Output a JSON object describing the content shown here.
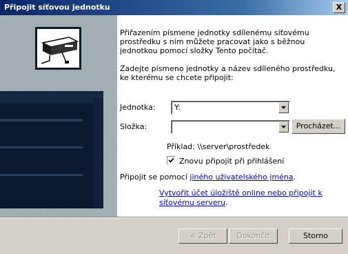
{
  "window": {
    "title": "Připojit síťovou jednotku",
    "close_label": "X"
  },
  "intro_text": "Přiřazením písmene jednotky sdílenému síťovému\nprostředku s ním můžete pracovat jako s běžnou\njednotkou pomocí složky Tento počítač.",
  "instruction_text": "Zadejte písmeno jednotky a název sdíleného prostředku,\nke kterému se chcete připojit:",
  "form": {
    "drive_label": "Jednotka:",
    "drive_value": "Y:",
    "folder_label": "Složka:",
    "folder_value": "",
    "browse_label": "Procházet..."
  },
  "example_text": "Příklad: \\\\server\\prostředek",
  "reconnect": {
    "label": "Znovu připojit při přihlášení",
    "checked": true
  },
  "connect_prefix": "Připojit se pomocí ",
  "link_other_user": "jiného uživatelského jména",
  "connect_suffix": ".",
  "link_online_storage_line1": "Vytvořit účet úložiště online nebo připojit k",
  "link_online_storage_line2": "síťovému serveru",
  "link_online_storage_suffix": ".",
  "buttons": {
    "back": "< Zpět",
    "finish": "Dokončit",
    "cancel": "Storno"
  },
  "colors": {
    "title_gradient_start": "#0a246a",
    "dialog_face": "#d4d0c8",
    "link": "#0000ee"
  }
}
